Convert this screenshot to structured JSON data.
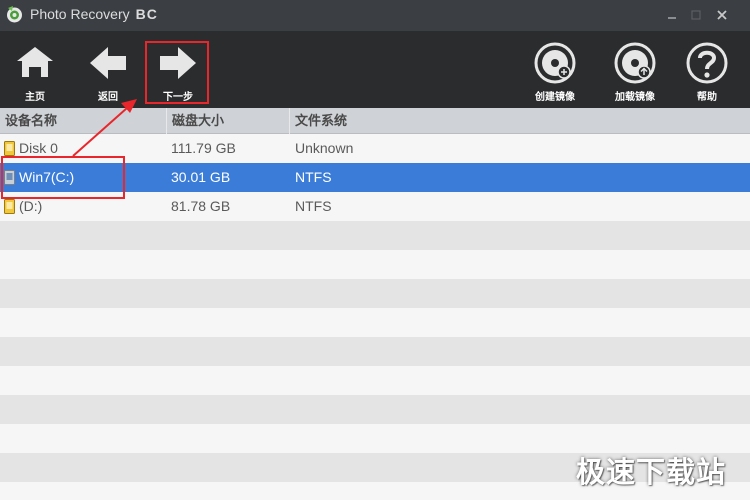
{
  "window": {
    "title": "Photo Recovery",
    "edition": "BC"
  },
  "toolbar": {
    "home": {
      "label": "主页",
      "icon": "home-icon"
    },
    "back": {
      "label": "返回",
      "icon": "arrow-left-icon"
    },
    "next": {
      "label": "下一步",
      "icon": "arrow-right-icon"
    },
    "create_image": {
      "label": "创建镜像",
      "icon": "disc-create-icon"
    },
    "load_image": {
      "label": "加载镜像",
      "icon": "disc-load-icon"
    },
    "help": {
      "label": "帮助",
      "icon": "help-icon"
    }
  },
  "table": {
    "columns": [
      "设备名称",
      "磁盘大小",
      "文件系统"
    ],
    "rows": [
      {
        "name": "Disk 0",
        "size": "111.79 GB",
        "fs": "Unknown"
      },
      {
        "name": "Win7(C:)",
        "size": "30.01 GB",
        "fs": "NTFS"
      },
      {
        "name": "(D:)",
        "size": "81.78 GB",
        "fs": "NTFS"
      }
    ],
    "selected_row": 1
  },
  "watermark": "极速下载站",
  "colors": {
    "titlebar": "#3b3f44",
    "toolbar": "#2b2c2e",
    "selection": "#3a7cd8",
    "annotation": "#e8262b",
    "header": "#cfd2d6"
  }
}
